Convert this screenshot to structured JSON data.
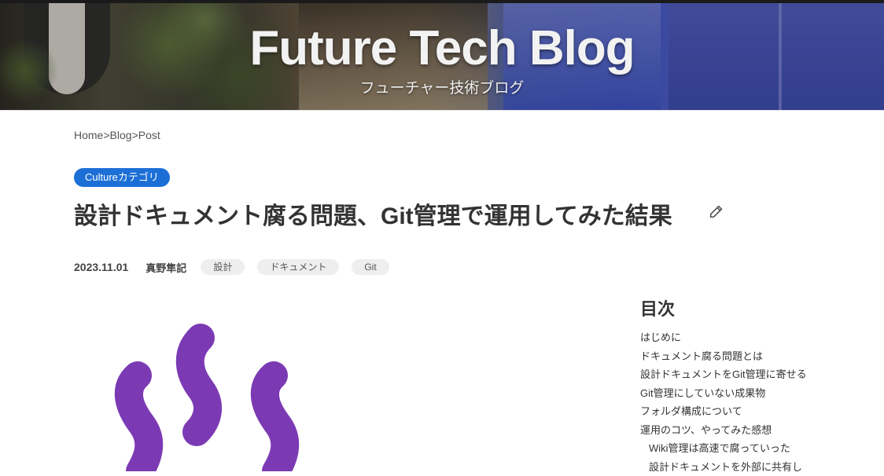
{
  "header": {
    "site_title": "Future Tech Blog",
    "site_subtitle": "フューチャー技術ブログ"
  },
  "breadcrumb": {
    "home": "Home",
    "sep1": ">",
    "blog": "Blog",
    "sep2": ">",
    "post": "Post"
  },
  "post": {
    "category": "Cultureカテゴリ",
    "title": "設計ドキュメント腐る問題、Git管理で運用してみた結果",
    "date": "2023.11.01",
    "author": "真野隼記",
    "tags": [
      "設計",
      "ドキュメント",
      "Git"
    ]
  },
  "toc": {
    "title": "目次",
    "items": [
      "はじめに",
      "ドキュメント腐る問題とは",
      "設計ドキュメントをGit管理に寄せる",
      "Git管理にしていない成果物",
      "フォルダ構成について",
      "運用のコツ、やってみた感想",
      "Wiki管理は高速で腐っていった",
      "設計ドキュメントを外部に共有し"
    ]
  },
  "colors": {
    "category_badge": "#1c6fd6",
    "illustration": "#7b3ab4",
    "text": "#333333"
  },
  "icons": {
    "edit": "pencil-icon",
    "illustration": "steam-icon"
  }
}
